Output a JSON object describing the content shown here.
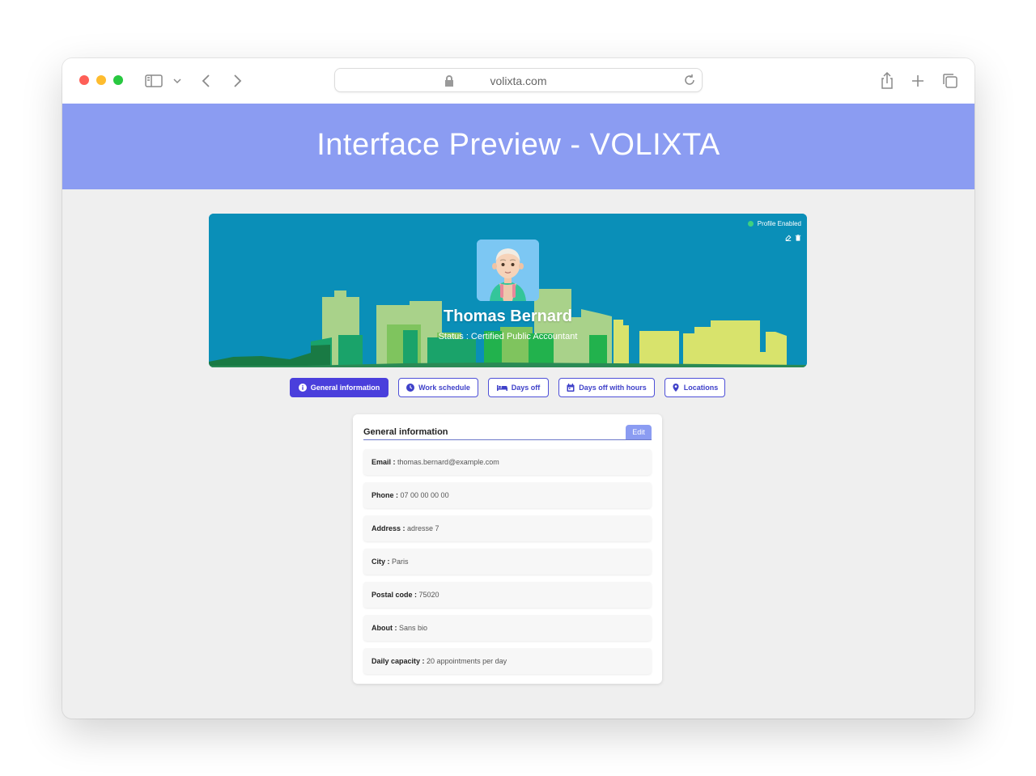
{
  "browser": {
    "url": "volixta.com"
  },
  "banner": {
    "title": "Interface Preview - VOLIXTA"
  },
  "profile": {
    "status_label": "Profile Enabled",
    "name": "Thomas Bernard",
    "role": "Status : Certified Public Accountant"
  },
  "tabs": [
    {
      "label": "General information",
      "icon": "info-icon",
      "active": true
    },
    {
      "label": "Work schedule",
      "icon": "clock-icon",
      "active": false
    },
    {
      "label": "Days off",
      "icon": "bed-icon",
      "active": false
    },
    {
      "label": "Days off with hours",
      "icon": "calendar-icon",
      "active": false
    },
    {
      "label": "Locations",
      "icon": "map-pin-icon",
      "active": false
    }
  ],
  "card": {
    "title": "General information",
    "edit_label": "Edit",
    "fields": [
      {
        "label": "Email :",
        "value": "thomas.bernard@example.com"
      },
      {
        "label": "Phone :",
        "value": "07 00 00 00 00"
      },
      {
        "label": "Address :",
        "value": "adresse 7"
      },
      {
        "label": "City :",
        "value": "Paris"
      },
      {
        "label": "Postal code :",
        "value": "75020"
      },
      {
        "label": "About :",
        "value": "Sans bio"
      },
      {
        "label": "Daily capacity :",
        "value": "20 appointments per day"
      }
    ]
  },
  "colors": {
    "banner": "#8b9cf2",
    "hero": "#0a8fb8",
    "accent": "#4a3fdc"
  }
}
